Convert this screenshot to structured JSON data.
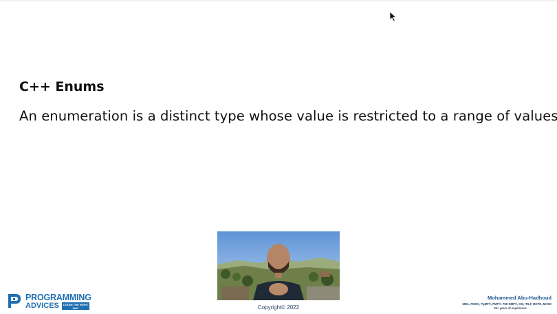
{
  "slide": {
    "title": "C++ Enums",
    "body": "An enumeration is a distinct type whose value is restricted to a range of values"
  },
  "webcam": {
    "copyright": "Copyright© 2022"
  },
  "branding": {
    "logo_line1": "PROGRAMMING",
    "logo_line2": "ADVICES",
    "logo_tagline": "LEARN THE RIGHT WAY",
    "brand_color": "#1f6fb2"
  },
  "author": {
    "name": "Mohammed Abu-Hadhoud",
    "credentials": "MBA, PMOC, PgMP®, PMP®, PMI-RMP®, CM, ITILF, MCPD, MCSD",
    "experience": "26+ years of experience"
  },
  "icons": {
    "cursor": "mouse-pointer-icon",
    "logo": "programming-advices-logo-icon"
  }
}
